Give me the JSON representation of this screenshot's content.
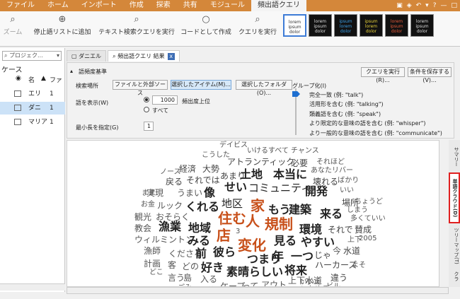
{
  "menu": {
    "tabs": [
      "ファイル",
      "ホーム",
      "インポート",
      "作成",
      "探索",
      "共有",
      "モジュール",
      "頻出語クエリ"
    ],
    "active_index": 7
  },
  "ribbon": {
    "zoom": "ズーム",
    "add_stop": "停止語リストに追加",
    "run_text_search": "テキスト検索クエリを実行",
    "create_code": "コードとして作成",
    "run_query": "クエリを実行"
  },
  "thumbnails": [
    [
      "lorem",
      "ipsum",
      "dolor"
    ],
    [
      "lorem",
      "ipsum",
      "dolor"
    ],
    [
      "ipsum",
      "lorem",
      "dolor"
    ],
    [
      "ipsum",
      "lorem",
      "dolor"
    ],
    [
      "lorem",
      "ipsum",
      "dolor"
    ],
    [
      "lorem",
      "ipsum",
      "dolor"
    ]
  ],
  "left_pane": {
    "search_placeholder": "プロジェク...",
    "heading": "ケース",
    "col_name": "名",
    "col_files": "ファ",
    "rows": [
      {
        "name": "エリ",
        "count": "1"
      },
      {
        "name": "ダニ",
        "count": "1"
      },
      {
        "name": "マリア",
        "count": "1"
      }
    ]
  },
  "doc_tabs": {
    "tab1": "ダニエル",
    "tab2": "頻出語クエリ 結果",
    "close": "x"
  },
  "criteria": {
    "section": "語頻度基準",
    "search_in": "検索場所",
    "btn_files": "ファイルと外部ソース",
    "btn_selected": "選択したアイテム(M)...",
    "btn_folders": "選択したフォルダ(O)...",
    "display_words": "語を表示(W)",
    "count_value": "1000",
    "top_freq": "頻出度上位",
    "all": "すべて",
    "min_length": "最小長を指定(G)",
    "min_value": "1",
    "grouping": "グループ化(I)",
    "group_options": [
      "完全一致 (例: \"talk\")",
      "活用形を含む (例: \"talking\")",
      "類義語を含む (例: \"speak\")",
      "より限定的な意味の語を含む (例: \"whisper\")",
      "より一般的な意味の語を含む (例: \"communicate\")"
    ],
    "run_btn": "クエリを実行(R)...",
    "save_btn": "条件を保存する(V)..."
  },
  "right_tabs": [
    "サマリー",
    "単語クラウド(D)",
    "ツリーマップ(T)",
    "クラ"
  ],
  "accent_color": "#d4873a",
  "highlight_color": "#c8501a",
  "cloud_words": [
    "デイビス",
    "いける",
    "すべて",
    "チャンス",
    "こうした",
    "アトランティック",
    "必要",
    "それほど",
    "ノース",
    "経済",
    "大勢",
    "あなた",
    "リバー",
    "まま",
    "戻る",
    "それでは",
    "あまり",
    "土地",
    "本当に",
    "壊れる",
    "ばかり",
    "実現",
    "うまい",
    "像",
    "せい",
    "コミュニティ",
    "開発",
    "いい",
    "お金",
    "ルック",
    "地区",
    "家",
    "場所",
    "ちょうど",
    "観光",
    "おそらく",
    "くれる",
    "住む",
    "人",
    "もう",
    "建築",
    "来る",
    "しまう",
    "多くていい",
    "教会",
    "漁業",
    "地域",
    "店",
    "規制",
    "環境",
    "それで",
    "賛成",
    "ウィルミントン",
    "みる",
    "3",
    "変化",
    "見る",
    "やすい",
    "上下",
    "2005",
    "漁師",
    "くださる",
    "前",
    "彼ら",
    "つまり",
    "年",
    "一つ",
    "じゃ",
    "今",
    "水道",
    "計画",
    "どこ",
    "客",
    "どの",
    "好き",
    "素晴らしい",
    "将来",
    "ハーカーズ",
    "よそ",
    "言う",
    "島",
    "入る",
    "いいえ",
    "違う",
    "ごみ",
    "最後",
    "ケープ",
    "って",
    "アウト",
    "上下水道",
    "いわゆる",
    "ビル"
  ]
}
